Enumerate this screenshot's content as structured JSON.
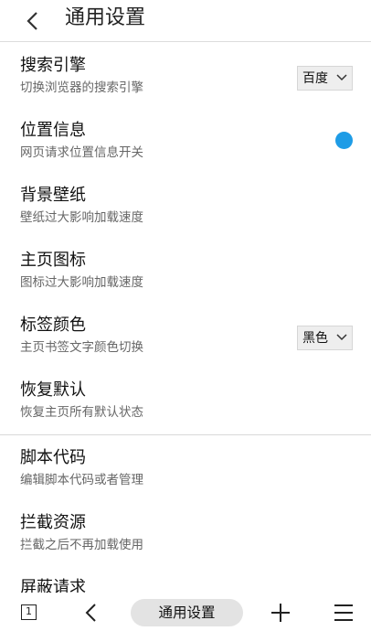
{
  "header": {
    "title": "通用设置"
  },
  "items": [
    {
      "title": "搜索引擎",
      "sub": "切换浏览器的搜索引擎",
      "control": "select",
      "value": "百度"
    },
    {
      "title": "位置信息",
      "sub": "网页请求位置信息开关",
      "control": "toggle",
      "on": true
    },
    {
      "title": "背景壁纸",
      "sub": "壁纸过大影响加载速度"
    },
    {
      "title": "主页图标",
      "sub": "图标过大影响加载速度"
    },
    {
      "title": "标签颜色",
      "sub": "主页书签文字颜色切换",
      "control": "select",
      "value": "黑色"
    },
    {
      "title": "恢复默认",
      "sub": "恢复主页所有默认状态"
    },
    {
      "title": "脚本代码",
      "sub": "编辑脚本代码或者管理"
    },
    {
      "title": "拦截资源",
      "sub": "拦截之后不再加载使用"
    },
    {
      "title": "屏蔽请求",
      "sub": ""
    }
  ],
  "bottom_bar": {
    "tab_count": "1",
    "center_label": "通用设置"
  },
  "icons": {
    "back": "chevron-left-icon",
    "tabs": "tabs-icon",
    "prev": "chevron-left-icon",
    "plus": "plus-icon",
    "menu": "menu-icon",
    "dropdown": "chevron-down-icon"
  },
  "colors": {
    "accent": "#1e9ce6",
    "select_bg": "#eeeeee",
    "pill_bg": "#e3e3e3"
  }
}
